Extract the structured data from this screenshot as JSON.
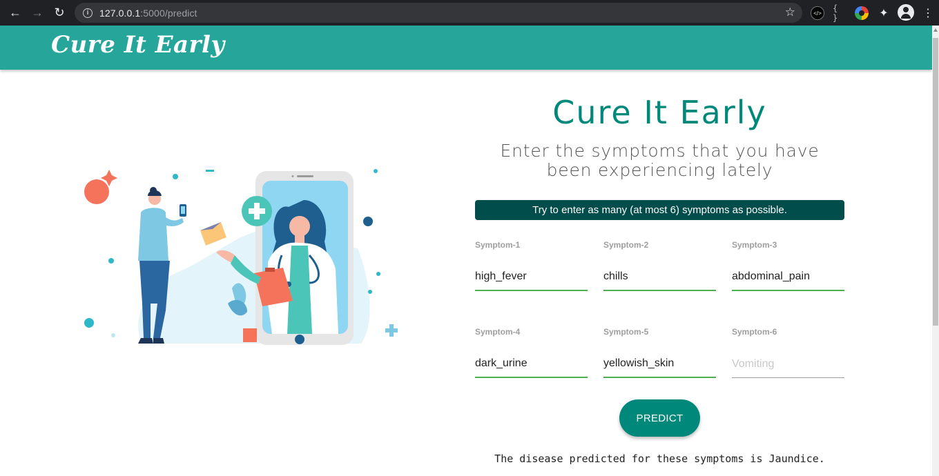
{
  "browser": {
    "url_host": "127.0.0.1",
    "url_path": ":5000/predict"
  },
  "navbar": {
    "brand": "Cure It Early"
  },
  "main": {
    "title": "Cure It Early",
    "subtitle": "Enter the symptoms that you have been experiencing lately",
    "banner": "Try to enter as many (at most 6) symptoms as possible.",
    "symptoms": [
      {
        "label": "Symptom-1",
        "value": "high_fever",
        "placeholder": ""
      },
      {
        "label": "Symptom-2",
        "value": "chills",
        "placeholder": ""
      },
      {
        "label": "Symptom-3",
        "value": "abdominal_pain",
        "placeholder": ""
      },
      {
        "label": "Symptom-4",
        "value": "dark_urine",
        "placeholder": ""
      },
      {
        "label": "Symptom-5",
        "value": "yellowish_skin",
        "placeholder": ""
      },
      {
        "label": "Symptom-6",
        "value": "",
        "placeholder": "Vomiting"
      }
    ],
    "predict_label": "PREDICT",
    "result": "The disease predicted for these symptoms is Jaundice."
  },
  "colors": {
    "navbar": "#26a69a",
    "title": "#00897b",
    "banner": "#004d4b",
    "input_underline": "#4caf50",
    "button": "#00897b"
  }
}
